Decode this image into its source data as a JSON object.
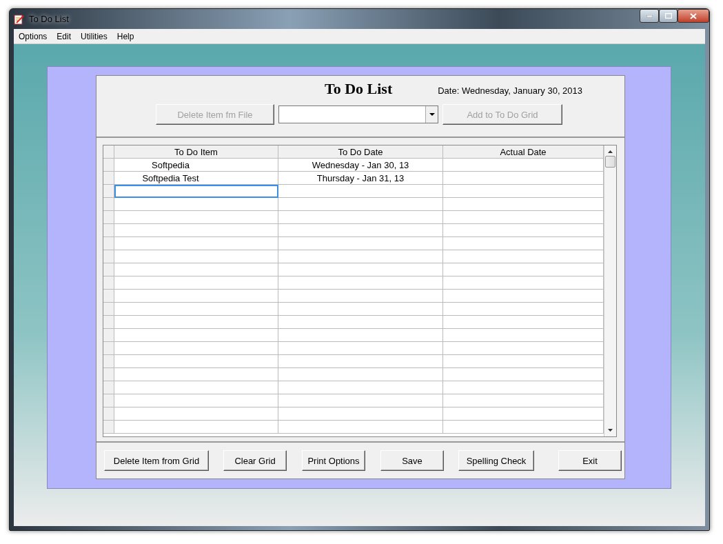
{
  "window": {
    "title": "To Do List"
  },
  "menu": [
    "Options",
    "Edit",
    "Utilities",
    "Help"
  ],
  "form": {
    "title": "To Do List",
    "date": "Date: Wednesday, January 30, 2013",
    "delete_file_button": {
      "label": "Delete Item fm File",
      "disabled": true
    },
    "item_dropdown": {
      "open": false
    },
    "add_button": {
      "label": "Add to To Do Grid",
      "disabled": true
    }
  },
  "grid": {
    "columns": [
      "To Do Item",
      "To Do Date",
      "Actual Date"
    ],
    "rows": [
      {
        "item": "Softpedia",
        "todo_date": "Wednesday - Jan 30, 13"
      },
      {
        "item": "Softpedia Test",
        "todo_date": "Thursday - Jan 31, 13"
      }
    ],
    "input_row": {
      "focused": true
    }
  },
  "buttons": [
    {
      "label": "Delete Item from Grid"
    },
    {
      "label": "Clear Grid"
    },
    {
      "label": "Print Options"
    },
    {
      "label": "Save"
    },
    {
      "label": "Spelling Check"
    },
    {
      "label": "Exit"
    }
  ]
}
